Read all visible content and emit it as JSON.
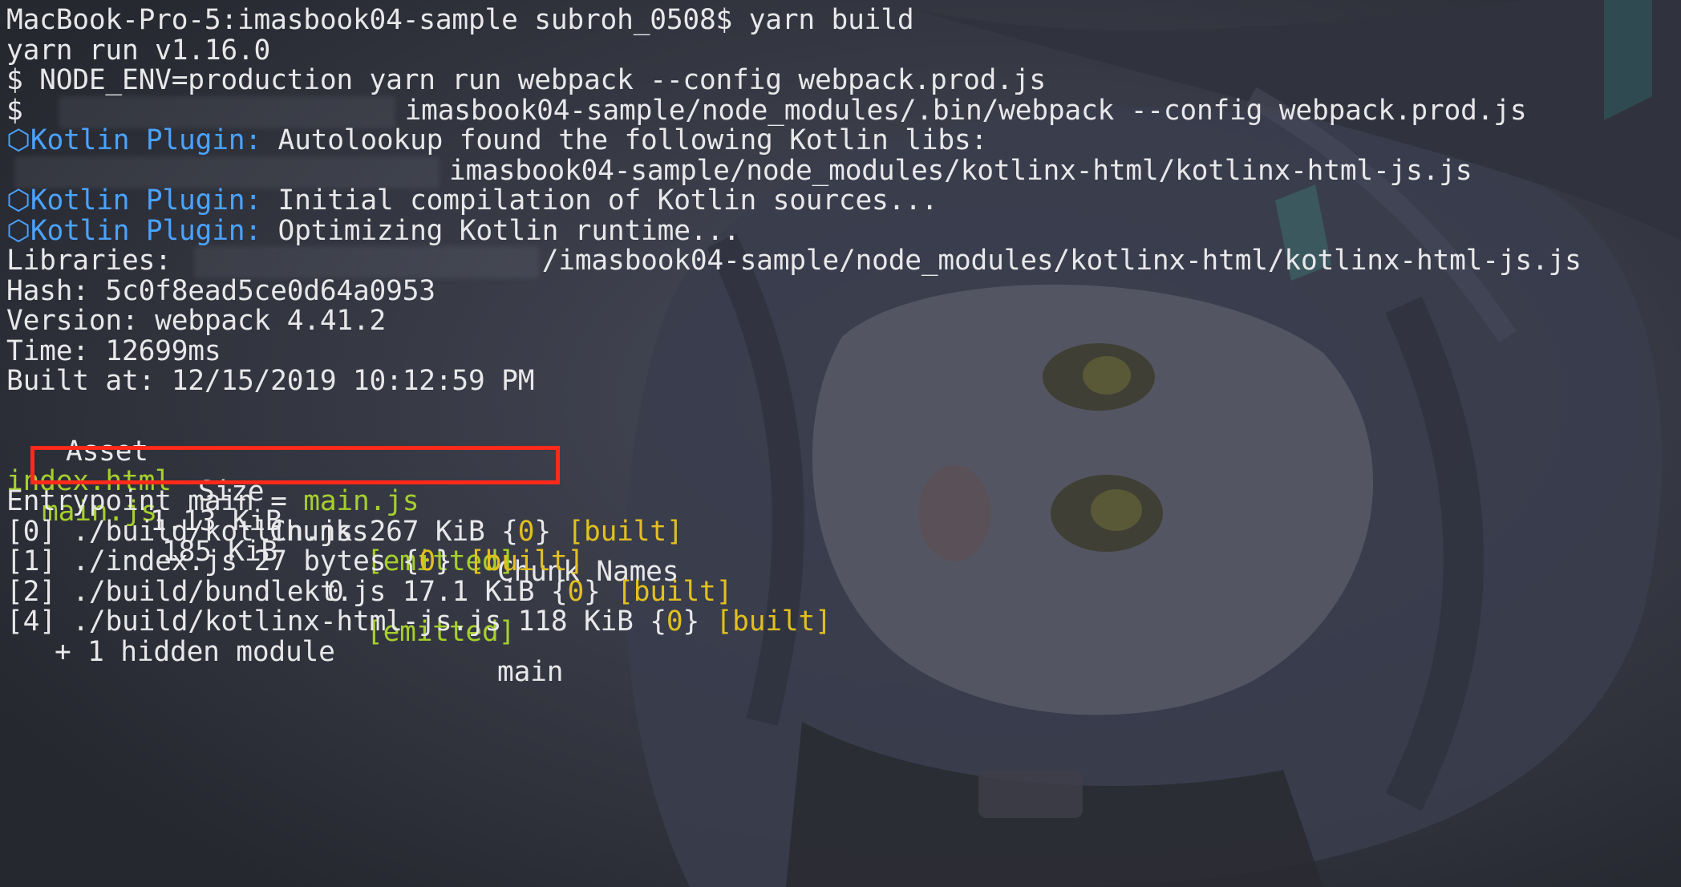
{
  "colors": {
    "background": "#2b2d35",
    "text": "#e8e8ea",
    "plugin_label": "#4aa3ff",
    "asset_name": "#a6cf2d",
    "status_tag": "#e2c01f",
    "highlight_box": "#ff2a1a"
  },
  "icons": {
    "kotlin_plugin": "hexagon-icon"
  },
  "lines": {
    "prompt": "MacBook-Pro-5:imasbook04-sample subroh_0508$ yarn build",
    "yarn_version": "yarn run v1.16.0",
    "cmd_node_env": "$ NODE_ENV=production yarn run webpack --config webpack.prod.js",
    "cmd_webpack_prefix": "$",
    "cmd_webpack_path": "imasbook04-sample/node_modules/.bin/webpack --config webpack.prod.js",
    "kotlin_plugin_label": "Kotlin Plugin:",
    "kp_autolookup": "Autolookup found the following Kotlin libs:",
    "kp_lib_path": "imasbook04-sample/node_modules/kotlinx-html/kotlinx-html-js.js",
    "kp_initial": "Initial compilation of Kotlin sources...",
    "kp_optimizing": "Optimizing Kotlin runtime...",
    "libraries_label": "Libraries:",
    "libraries_path": "/imasbook04-sample/node_modules/kotlinx-html/kotlinx-html-js.js",
    "hash": "Hash: 5c0f8ead5ce0d64a0953",
    "version": "Version: webpack 4.41.2",
    "time": "Time: 12699ms",
    "built_at": "Built at: 12/15/2019 10:12:59 PM"
  },
  "asset_table": {
    "headers": {
      "asset": "Asset",
      "size": "Size",
      "chunks": "Chunks",
      "chunk_names": "Chunk Names"
    },
    "rows": [
      {
        "asset": "index.html",
        "size": "1.13 KiB",
        "chunks": "",
        "status": "[emitted]",
        "chunk_names": ""
      },
      {
        "asset": "main.js",
        "size": "185 KiB",
        "chunks": "0",
        "status": "[emitted]",
        "chunk_names": "main"
      }
    ]
  },
  "entrypoint": {
    "prefix": "Entrypoint main =",
    "file": "main.js"
  },
  "modules": [
    {
      "index": "[0]",
      "path": "./build/kotlin.js",
      "size": "267 KiB",
      "chunk": "0",
      "status": "[built]"
    },
    {
      "index": "[1]",
      "path": "./index.js",
      "size": "27 bytes",
      "chunk": "0",
      "status": "[built]"
    },
    {
      "index": "[2]",
      "path": "./build/bundlekt.js",
      "size": "17.1 KiB",
      "chunk": "0",
      "status": "[built]"
    },
    {
      "index": "[4]",
      "path": "./build/kotlinx-html-js.js",
      "size": "118 KiB",
      "chunk": "0",
      "status": "[built]"
    }
  ],
  "hidden_modules": "+ 1 hidden module"
}
